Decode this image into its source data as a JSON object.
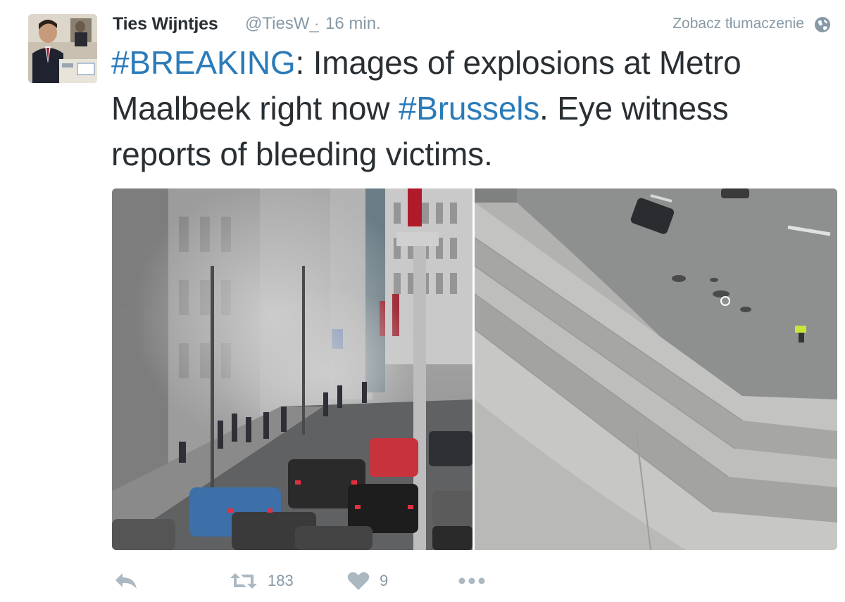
{
  "tweet": {
    "author_name": "Ties Wijntjes",
    "author_handle": "@TiesW_",
    "separator": "·",
    "timestamp": "16 min.",
    "translate_link": "Zobacz tłumaczenie",
    "text_parts": {
      "hashtag_breaking": "#BREAKING",
      "segment_1": ": Images of explosions at Metro Maalbeek right now ",
      "hashtag_brussels": "#Brussels",
      "segment_2": ".  Eye witness reports of bleeding victims."
    },
    "actions": {
      "retweet_count": "183",
      "like_count": "9"
    }
  },
  "icons": {
    "avatar": "avatar-photo",
    "globe": "globe-icon",
    "reply": "reply-icon",
    "retweet": "retweet-icon",
    "like": "heart-icon",
    "more": "more-dots-icon"
  },
  "colors": {
    "text": "#292f33",
    "muted": "#8899a6",
    "link": "#2b7bb9",
    "background": "#ffffff"
  }
}
